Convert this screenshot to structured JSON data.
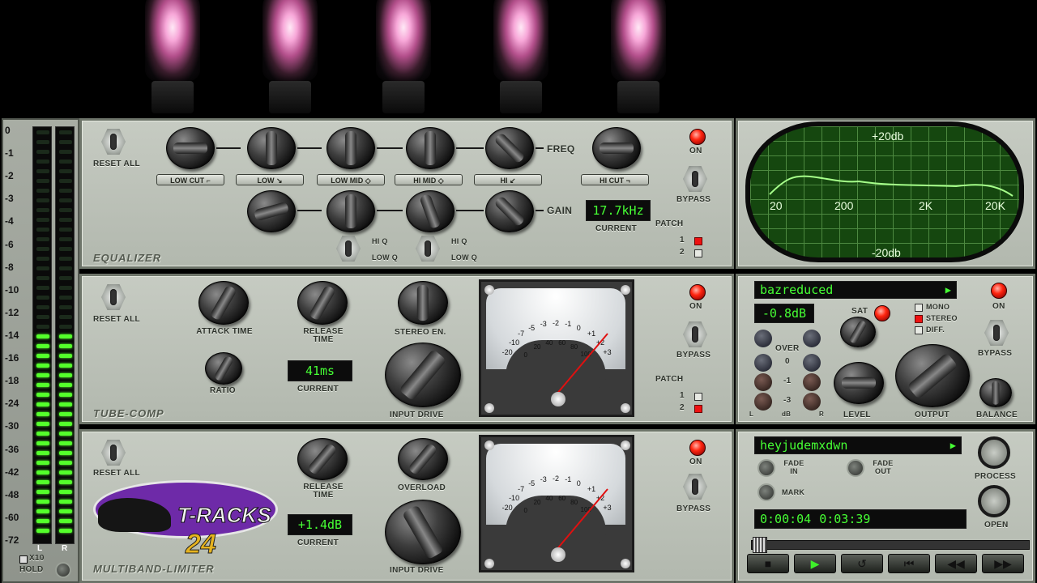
{
  "meter": {
    "scale": [
      "0",
      "-1",
      "-2",
      "-3",
      "-4",
      "-6",
      "-8",
      "-10",
      "-12",
      "-14",
      "-16",
      "-18",
      "-24",
      "-30",
      "-36",
      "-42",
      "-48",
      "-60",
      "-72"
    ],
    "left_label": "L",
    "right_label": "R",
    "x10_label": "X10",
    "hold_label": "HOLD",
    "level_fraction": 0.5
  },
  "eq": {
    "title": "EQUALIZER",
    "reset_label": "RESET ALL",
    "bands": [
      "LOW CUT",
      "LOW",
      "LOW MID",
      "HI MID",
      "HI",
      "HI CUT"
    ],
    "freq_label": "FREQ",
    "gain_label": "GAIN",
    "current_value": "17.7kHz",
    "current_label": "CURRENT",
    "hi_q": "HI Q",
    "low_q": "LOW Q",
    "on_label": "ON",
    "bypass_label": "BYPASS",
    "patch_label": "PATCH",
    "patch1": "1",
    "patch2": "2"
  },
  "scope": {
    "top": "+20db",
    "bottom": "-20db",
    "freqs": [
      "20",
      "200",
      "2K",
      "20K"
    ]
  },
  "comp": {
    "title": "TUBE-COMP",
    "reset_label": "RESET ALL",
    "attack_label": "ATTACK TIME",
    "release_label": "RELEASE TIME",
    "stereo_label": "STEREO EN.",
    "ratio_label": "RATIO",
    "current_value": "41ms",
    "current_label": "CURRENT",
    "input_drive_label": "INPUT DRIVE",
    "on_label": "ON",
    "bypass_label": "BYPASS",
    "patch_label": "PATCH",
    "patch1": "1",
    "patch2": "2"
  },
  "vu_scale": [
    "-20",
    "-10",
    "-7",
    "-5",
    "-3",
    "-2",
    "-1",
    "0",
    "+1",
    "+2",
    "+3",
    "0",
    "20",
    "40",
    "60",
    "80",
    "100"
  ],
  "output": {
    "preset": "bazreduced",
    "gain_value": "-0.8dB",
    "sat_label": "SAT",
    "mono_label": "MONO",
    "stereo_label": "STEREO",
    "diff_label": "DIFF.",
    "over_label": "OVER",
    "l0": "0",
    "l1": "-1",
    "l3": "-3",
    "db_label": "dB",
    "l_label": "L",
    "r_label": "R",
    "level_label": "LEVEL",
    "output_label": "OUTPUT",
    "balance_label": "BALANCE",
    "on_label": "ON",
    "bypass_label": "BYPASS"
  },
  "limiter": {
    "title": "MULTIBAND-LIMITER",
    "reset_label": "RESET ALL",
    "release_label": "RELEASE TIME",
    "overload_label": "OVERLOAD",
    "current_value": "+1.4dB",
    "current_label": "CURRENT",
    "input_drive_label": "INPUT DRIVE",
    "on_label": "ON",
    "bypass_label": "BYPASS",
    "logo_text": "T-RACKS",
    "logo_num": "24"
  },
  "player": {
    "track": "heyjudemxdwn",
    "fade_in": "FADE IN",
    "fade_out": "FADE OUT",
    "mark": "MARK",
    "time_current": "0:00:04",
    "time_total": "0:03:39",
    "process_label": "PROCESS",
    "open_label": "OPEN",
    "play_indicator": "▶"
  },
  "transport": [
    "■",
    "▶",
    "↺",
    "⏮",
    "◀◀",
    "▶▶"
  ]
}
